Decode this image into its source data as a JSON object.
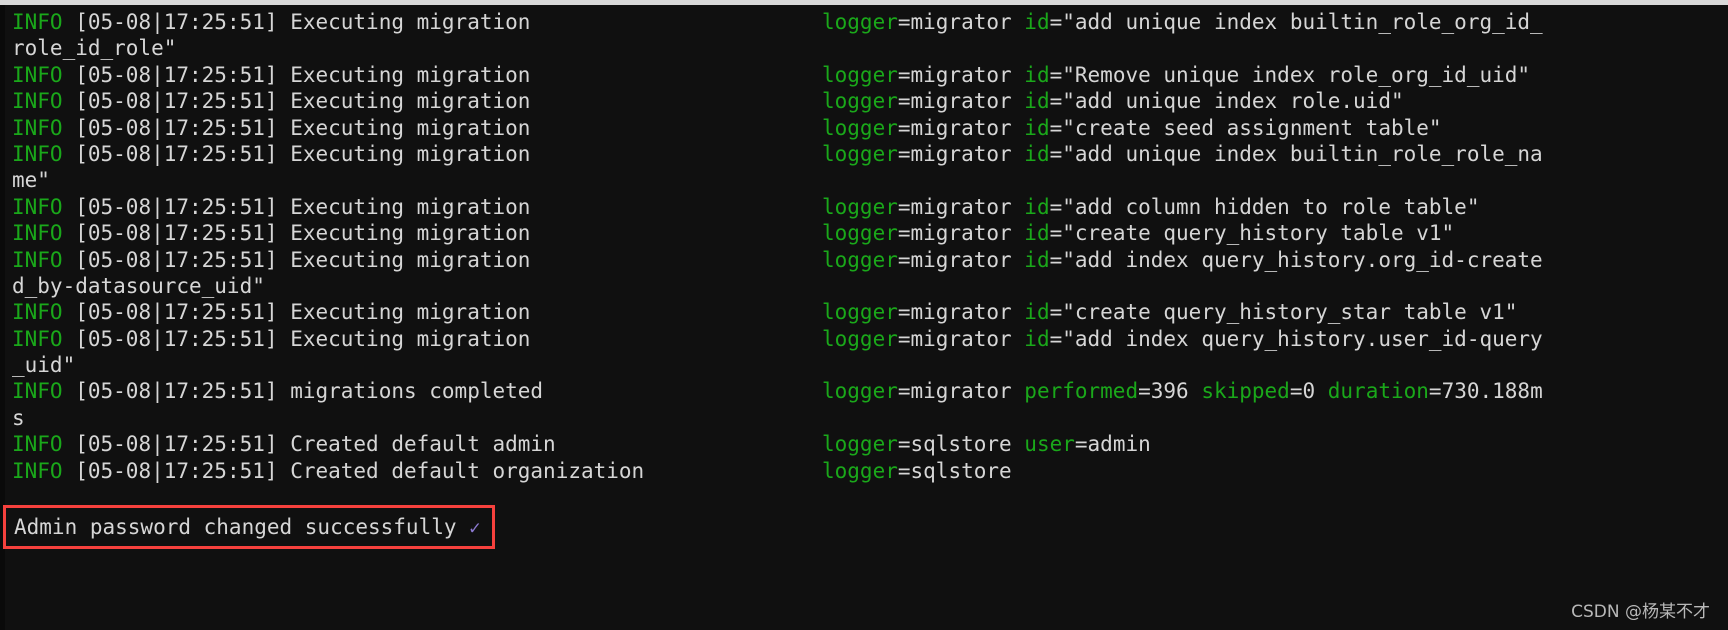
{
  "terminal": {
    "background_color": "#101010",
    "foreground_color": "#d6d6d6",
    "level_color": "#1aa81a",
    "key_color": "#1aa81a",
    "lines": [
      {
        "level": "INFO",
        "timestamp": "[05-08|17:25:51]",
        "message": "Executing migration",
        "fields": "logger=migrator id=\"add unique index builtin_role_org_id_"
      },
      {
        "wrap": "role_id_role\""
      },
      {
        "level": "INFO",
        "timestamp": "[05-08|17:25:51]",
        "message": "Executing migration",
        "fields": "logger=migrator id=\"Remove unique index role_org_id_uid\""
      },
      {
        "level": "INFO",
        "timestamp": "[05-08|17:25:51]",
        "message": "Executing migration",
        "fields": "logger=migrator id=\"add unique index role.uid\""
      },
      {
        "level": "INFO",
        "timestamp": "[05-08|17:25:51]",
        "message": "Executing migration",
        "fields": "logger=migrator id=\"create seed assignment table\""
      },
      {
        "level": "INFO",
        "timestamp": "[05-08|17:25:51]",
        "message": "Executing migration",
        "fields": "logger=migrator id=\"add unique index builtin_role_role_na"
      },
      {
        "wrap": "me\""
      },
      {
        "level": "INFO",
        "timestamp": "[05-08|17:25:51]",
        "message": "Executing migration",
        "fields": "logger=migrator id=\"add column hidden to role table\""
      },
      {
        "level": "INFO",
        "timestamp": "[05-08|17:25:51]",
        "message": "Executing migration",
        "fields": "logger=migrator id=\"create query_history table v1\""
      },
      {
        "level": "INFO",
        "timestamp": "[05-08|17:25:51]",
        "message": "Executing migration",
        "fields": "logger=migrator id=\"add index query_history.org_id-create"
      },
      {
        "wrap": "d_by-datasource_uid\""
      },
      {
        "level": "INFO",
        "timestamp": "[05-08|17:25:51]",
        "message": "Executing migration",
        "fields": "logger=migrator id=\"create query_history_star table v1\""
      },
      {
        "level": "INFO",
        "timestamp": "[05-08|17:25:51]",
        "message": "Executing migration",
        "fields": "logger=migrator id=\"add index query_history.user_id-query"
      },
      {
        "wrap": "_uid\""
      },
      {
        "level": "INFO",
        "timestamp": "[05-08|17:25:51]",
        "message": "migrations completed",
        "fields": "logger=migrator performed=396 skipped=0 duration=730.188m"
      },
      {
        "wrap": "s"
      },
      {
        "level": "INFO",
        "timestamp": "[05-08|17:25:51]",
        "message": "Created default admin",
        "fields": "logger=sqlstore user=admin"
      },
      {
        "level": "INFO",
        "timestamp": "[05-08|17:25:51]",
        "message": "Created default organization",
        "fields": "logger=sqlstore"
      }
    ]
  },
  "annotation": {
    "box_color": "#f6413d",
    "text": "Admin password changed successfully ",
    "check_glyph": "✓",
    "check_color": "#8b79cf"
  },
  "watermark": {
    "text": "CSDN @杨某不才"
  }
}
